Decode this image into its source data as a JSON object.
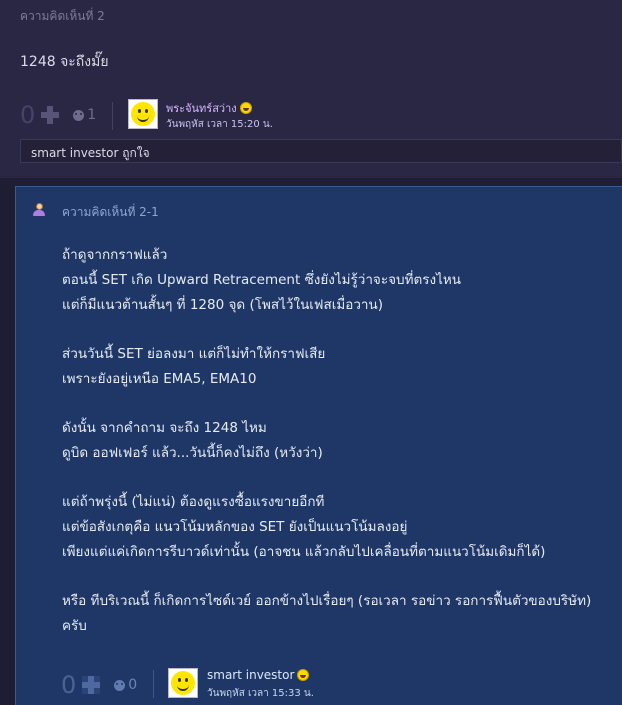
{
  "comment2": {
    "title": "ความคิดเห็นที่ 2",
    "body": "1248 จะถึงมั๊ย",
    "votes": "0",
    "emotions": "1",
    "author": "พระจันทร์สว่าง",
    "date": "วันพฤหัส เวลา 15:20 น.",
    "reply_input_value": "smart investor ถูกใจ"
  },
  "comment2_1": {
    "title": "ความคิดเห็นที่ 2-1",
    "paragraphs": [
      [
        "ถ้าดูจากกราฟแล้ว",
        "ตอนนี้ SET เกิด Upward Retracement ซึ่งยังไม่รู้ว่าจะจบที่ตรงไหน",
        "แต่ก็มีแนวต้านสั้นๆ ที่ 1280 จุด (โพสไว้ในเฟสเมื่อวาน)"
      ],
      [
        "ส่วนวันนี้ SET ย่อลงมา แต่ก็ไม่ทำให้กราฟเสีย",
        "เพราะยังอยู่เหนือ EMA5, EMA10"
      ],
      [
        "ดังนั้น จากคำถาม จะถึง 1248 ไหม",
        "ดูบิด ออฟเฟอร์ แล้ว...วันนี้ก็คงไม่ถึง (หวังว่า)"
      ],
      [
        "แต่ถ้าพรุ่งนี้ (ไม่แน่) ต้องดูแรงซื้อแรงขายอีกที",
        "แต่ข้อสังเกตุคือ แนวโน้มหลักของ SET ยังเป็นแนวโน้มลงอยู่",
        "เพียงแต่แค่เกิดการรีบาวด์เท่านั้น (อาจชน แล้วกลับไปเคลื่อนที่ตามแนวโน้มเดิมก็ได้)"
      ],
      [
        "หรือ ทีบริเวณนี้ ก็เกิดการไซด์เวย์ ออกข้างไปเรื่อยๆ (รอเวลา รอข่าว รอการฟื้นตัวของบริษัท)",
        "ครับ"
      ]
    ],
    "votes": "0",
    "emotions": "0",
    "author": "smart investor",
    "date": "วันพฤหัส เวลา 15:33 น."
  },
  "icons": {
    "plus": "plus-icon",
    "emotion": "emotion-icon",
    "author_smile": "smile-icon",
    "user": "user-icon",
    "avatar": "smiley-avatar"
  },
  "colors": {
    "comment2_bg": "#2a2744",
    "comment2_1_bg": "#1f3766",
    "author_name_purple": "#d8b6ff"
  }
}
